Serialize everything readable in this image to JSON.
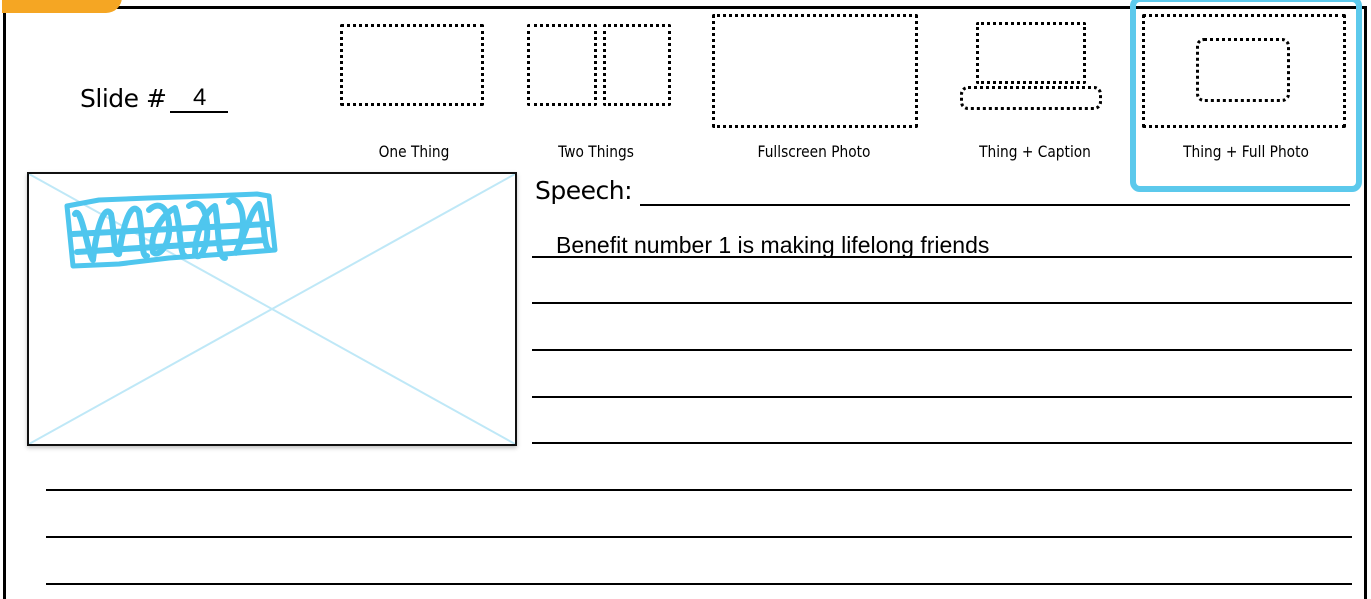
{
  "header": {
    "slide_label": "Slide #",
    "slide_number": "4"
  },
  "layouts": [
    {
      "label": "One Thing"
    },
    {
      "label": "Two Things"
    },
    {
      "label": "Fullscreen Photo"
    },
    {
      "label": "Thing + Caption"
    },
    {
      "label": "Thing + Full Photo",
      "selected": true
    }
  ],
  "photo": {
    "scribble": "scribble-drawing"
  },
  "speech": {
    "label": "Speech:",
    "lines": [
      "Benefit number 1 is making lifelong friends"
    ]
  },
  "colors": {
    "highlight": "#5cc9ec",
    "frame": "#000000",
    "tab": "#f5a623"
  }
}
